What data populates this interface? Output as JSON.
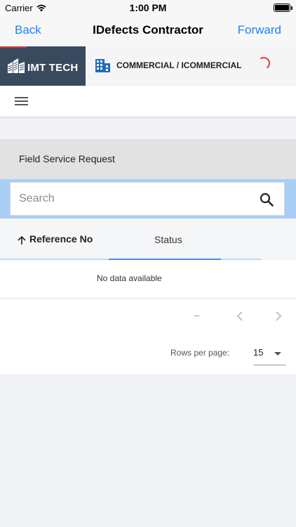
{
  "status_bar": {
    "carrier": "Carrier",
    "time": "1:00 PM"
  },
  "nav": {
    "back_label": "Back",
    "title": "IDefects Contractor",
    "forward_label": "Forward"
  },
  "app_header": {
    "logo_text": "IMT TECH",
    "breadcrumb": "COMMERCIAL / ICOMMERCIAL",
    "icons": [
      "buildings-logo-icon",
      "building-icon",
      "loading-spinner-icon"
    ]
  },
  "toolbar": {
    "icons": [
      "menu-icon"
    ]
  },
  "section": {
    "title": "Field Service Request"
  },
  "search": {
    "placeholder": "Search",
    "value": "",
    "icon": "search-icon"
  },
  "table": {
    "columns": [
      {
        "label": "Reference No",
        "sort": "ascending",
        "icon": "arrow-up-icon"
      },
      {
        "label": "Status"
      }
    ],
    "loading_progress": 0.43,
    "empty_message": "No data available"
  },
  "pagination": {
    "page_info": "–",
    "rows_per_page_label": "Rows per page:",
    "rows_per_page_value": "15",
    "icons": [
      "chevron-left-icon",
      "chevron-right-icon",
      "caret-down-icon"
    ]
  },
  "colors": {
    "link_blue": "#1a82fb",
    "logo_background": "#3a4a5e",
    "search_strip": "#a9cef6",
    "spinner_red": "#e53935",
    "progress_blue": "#4a8de0"
  }
}
